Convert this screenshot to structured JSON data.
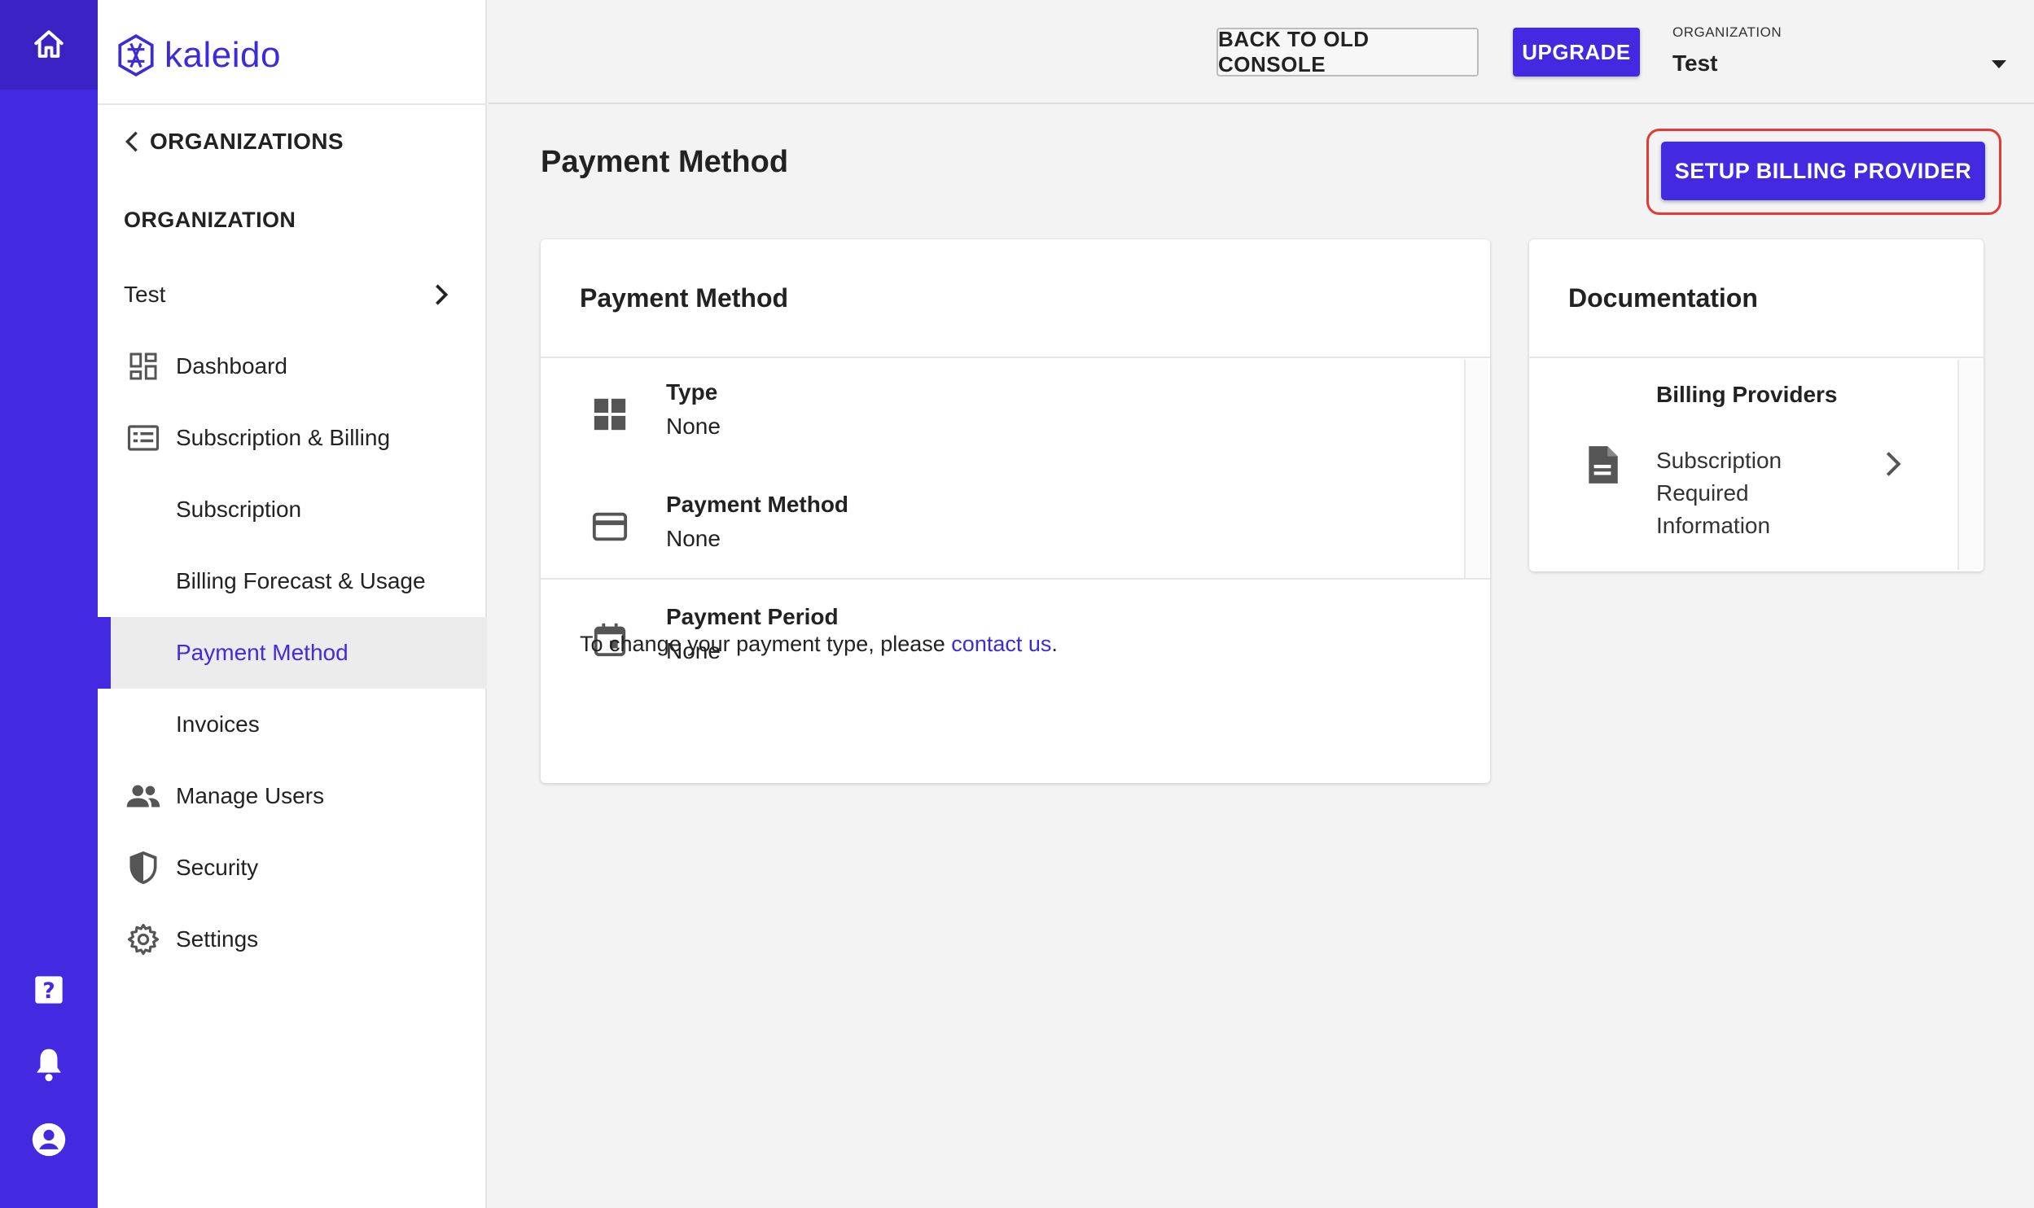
{
  "brand": {
    "name": "kaleido",
    "color": "#4329e0"
  },
  "rail": {
    "top_icon": "home-icon",
    "bottom_icons": [
      "help-icon",
      "bell-icon",
      "account-circle-icon"
    ]
  },
  "sidebar": {
    "back_label": "ORGANIZATIONS",
    "section_label": "ORGANIZATION",
    "org_name": "Test",
    "items": [
      {
        "label": "Dashboard",
        "icon": "dashboard-icon"
      },
      {
        "label": "Subscription & Billing",
        "icon": "billing-icon"
      },
      {
        "label": "Subscription"
      },
      {
        "label": "Billing Forecast & Usage"
      },
      {
        "label": "Payment Method",
        "active": true
      },
      {
        "label": "Invoices"
      },
      {
        "label": "Manage Users",
        "icon": "users-icon"
      },
      {
        "label": "Security",
        "icon": "shield-icon"
      },
      {
        "label": "Settings",
        "icon": "gear-icon"
      }
    ]
  },
  "topbar": {
    "back_console_label": "BACK TO OLD CONSOLE",
    "upgrade_label": "UPGRADE",
    "org_caption": "ORGANIZATION",
    "org_value": "Test"
  },
  "main": {
    "page_title": "Payment Method",
    "setup_button_label": "SETUP BILLING PROVIDER",
    "payment_card": {
      "title": "Payment Method",
      "items": [
        {
          "key": "Type",
          "value": "None",
          "icon": "grid-icon"
        },
        {
          "key": "Payment Method",
          "value": "None",
          "icon": "credit-card-icon"
        },
        {
          "key": "Payment Period",
          "value": "None",
          "icon": "calendar-icon"
        }
      ],
      "footer_text": "To change your payment type, please ",
      "footer_link": "contact us",
      "footer_end": "."
    },
    "doc_card": {
      "title": "Documentation",
      "item_title": "Billing Providers",
      "item_desc": "Subscription Required Information",
      "icon": "document-icon"
    }
  },
  "colors": {
    "accent": "#4329e0",
    "highlight": "#e53935",
    "link": "#3b2bd8"
  }
}
